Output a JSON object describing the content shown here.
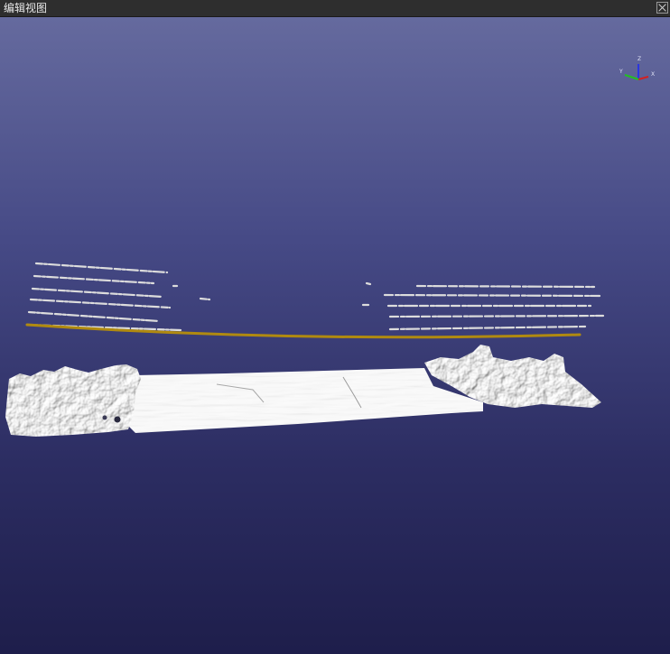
{
  "window": {
    "title": "编辑视图"
  },
  "axes": {
    "x_label": "X",
    "y_label": "Y",
    "z_label": "Z",
    "x_color": "#d42020",
    "y_color": "#22c022",
    "z_color": "#2a36e0"
  },
  "scene": {
    "background_top": "#656a9e",
    "background_bottom": "#1e1e4b",
    "point_cloud_color": "#eeeeee",
    "trajectory_color": "#b08a10",
    "icons": [
      "close-icon",
      "axis-gizmo-icon"
    ]
  }
}
